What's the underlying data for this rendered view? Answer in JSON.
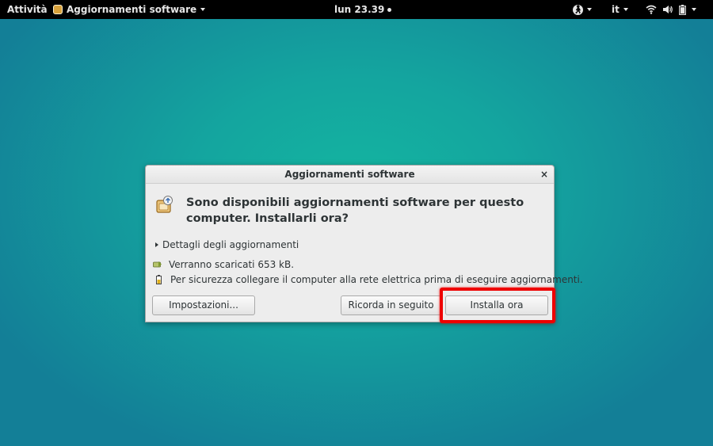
{
  "topbar": {
    "activities": "Attività",
    "app_name": "Aggiornamenti software",
    "clock": "lun 23.39",
    "language": "it",
    "icons": [
      "accessibility-icon",
      "wifi-icon",
      "volume-icon",
      "battery-icon"
    ]
  },
  "dialog": {
    "title": "Aggiornamenti software",
    "close": "×",
    "headline_line1": "Sono disponibili aggiornamenti software per questo",
    "headline_line2": "computer. Installarli ora?",
    "details_expander": "Dettagli degli aggiornamenti",
    "download_info": "Verranno scaricati 653 kB.",
    "power_warning": "Per sicurezza collegare il computer alla rete elettrica prima di eseguire aggiornamenti.",
    "buttons": {
      "settings": "Impostazioni...",
      "remind_later": "Ricorda in seguito",
      "install_now": "Installa ora"
    }
  },
  "colors": {
    "desktop_center": "#14b5a0",
    "desktop_edge": "#137f97",
    "highlight": "#ee0000"
  }
}
